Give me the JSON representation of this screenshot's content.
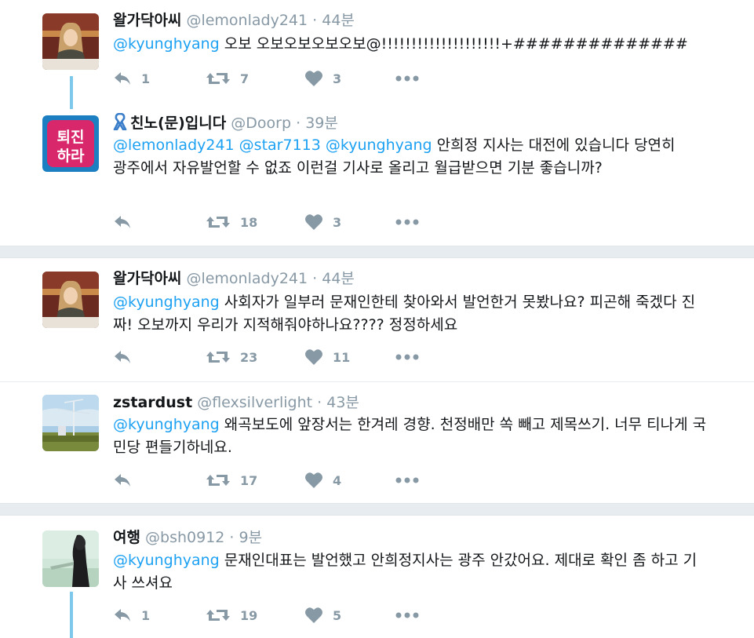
{
  "tweets": [
    {
      "name": "왈가닥아씨",
      "handle": "@lemonlady241",
      "dot": "·",
      "time": "44분",
      "mention": "@kyunghyang",
      "body": " 오보 오보오보오보오보@!!!!!!!!!!!!!!!!!!!!+##############",
      "reply_count": "1",
      "retweet_count": "7",
      "like_count": "3"
    },
    {
      "name": "친노(문)입니다",
      "handle": "@Doorp",
      "dot": "·",
      "time": "39분",
      "avatar_text_top": "퇴진",
      "avatar_text_bottom": "하라",
      "mention": "@lemonlady241 @star7113 @kyunghyang",
      "body": " 안희정 지사는 대전에 있습니다 당연히 광주에서 자유발언할 수 없죠 이런걸 기사로 올리고 월급받으면 기분 좋습니까?",
      "reply_count": "",
      "retweet_count": "18",
      "like_count": "3"
    },
    {
      "name": "왈가닥아씨",
      "handle": "@lemonlady241",
      "dot": "·",
      "time": "44분",
      "mention": "@kyunghyang",
      "body": " 사회자가 일부러 문재인한테 찾아와서 발언한거 못봤나요? 피곤해 죽겠다 진짜! 오보까지 우리가 지적해줘야하나요???? 정정하세요",
      "reply_count": "",
      "retweet_count": "23",
      "like_count": "11"
    },
    {
      "name": "zstardust",
      "handle": "@flexsilverlight",
      "dot": "·",
      "time": "43분",
      "mention": "@kyunghyang",
      "body": " 왜곡보도에 앞장서는 한겨레 경향. 천정배만 쏙 빼고 제목쓰기. 너무 티나게 국민당 편들기하네요.",
      "reply_count": "",
      "retweet_count": "17",
      "like_count": "4"
    },
    {
      "name": "여행",
      "handle": "@bsh0912",
      "dot": "·",
      "time": "9분",
      "mention": "@kyunghyang",
      "body": " 문재인대표는 발언했고 안희정지사는 광주 안갔어요. 제대로 확인 좀 하고 기사 쓰셔요",
      "reply_count": "1",
      "retweet_count": "19",
      "like_count": "5"
    }
  ],
  "colors": {
    "mention": "#1da1f2",
    "meta": "#8899a6",
    "thread_line": "#7ec8ec",
    "separator": "#e6ecf0"
  },
  "icons": [
    "reply-icon",
    "retweet-icon",
    "like-icon",
    "more-icon",
    "ribbon-icon"
  ]
}
